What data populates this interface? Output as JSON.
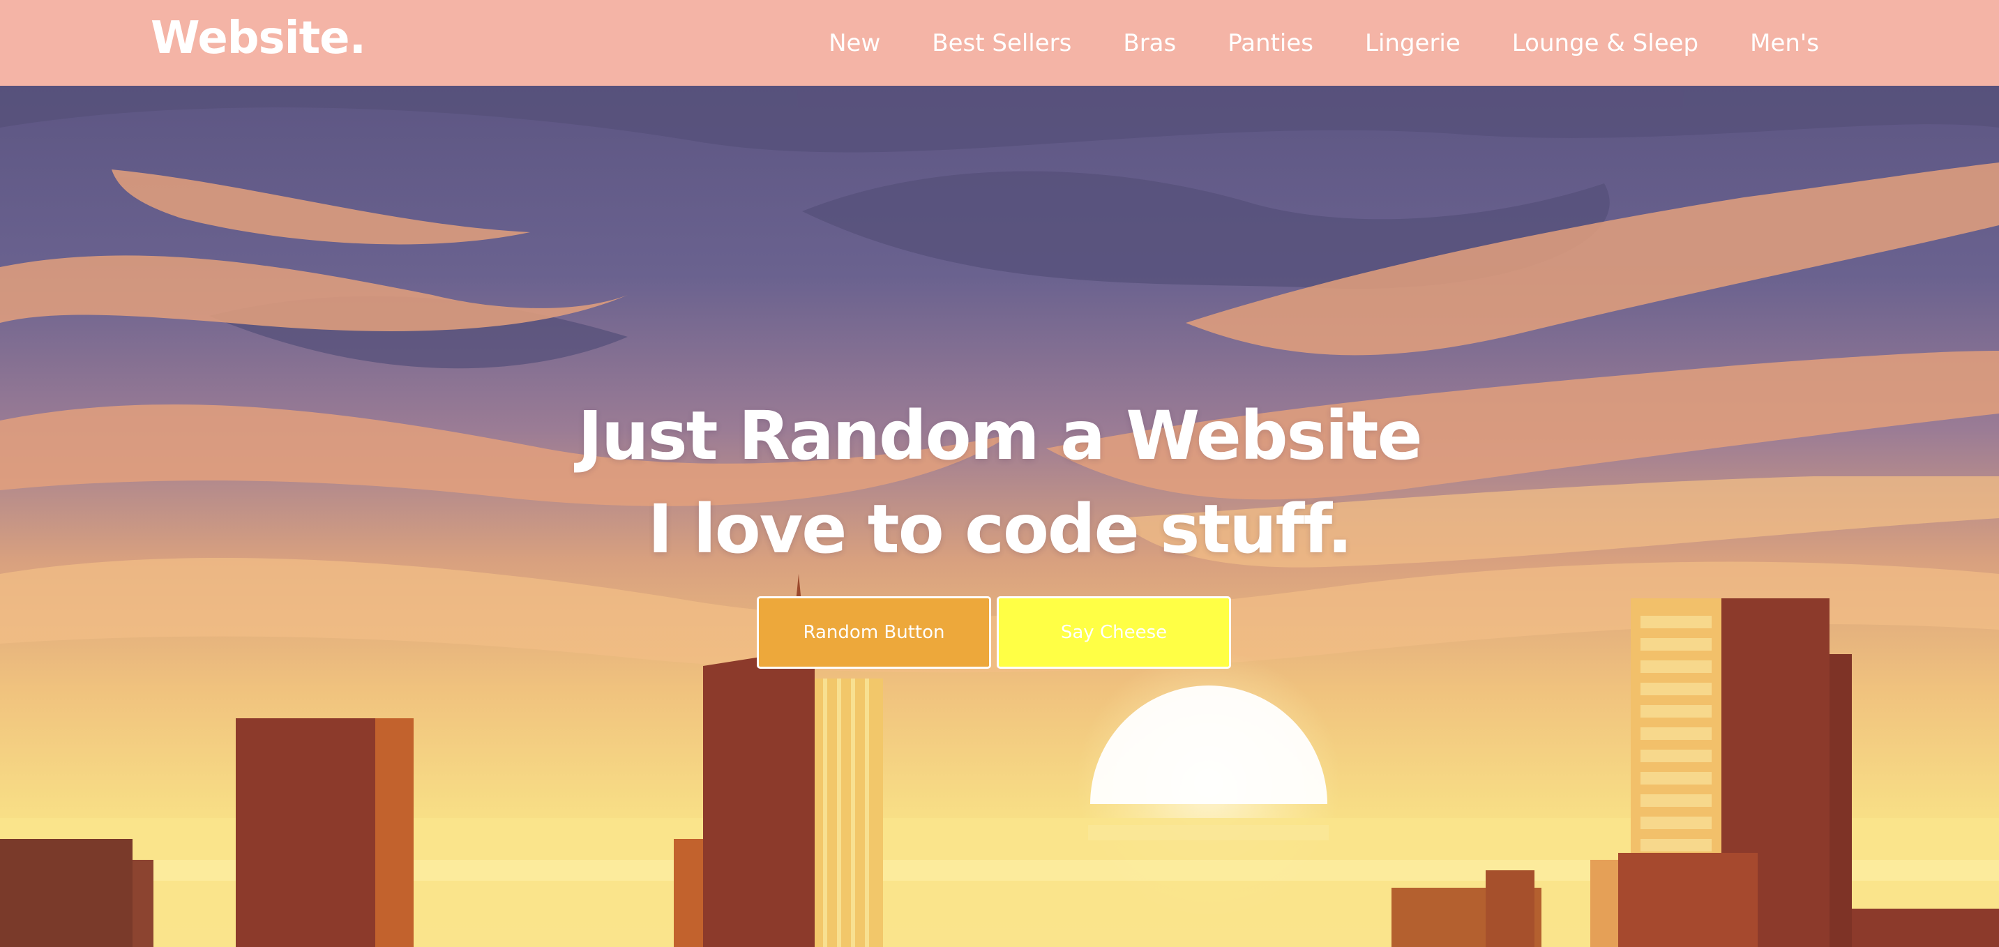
{
  "navbar": {
    "logo": "Website.",
    "links": [
      "New",
      "Best Sellers",
      "Bras",
      "Panties",
      "Lingerie",
      "Lounge & Sleep",
      "Men's"
    ]
  },
  "hero": {
    "title_line1": "Just Random a Website",
    "title_line2": "I love to code stuff.",
    "buttons": {
      "primary_label": "Random Button",
      "secondary_label": "Say Cheese"
    }
  },
  "colors": {
    "navbar_bg": "#f4b4a6",
    "primary_button": "#eda83b",
    "secondary_button": "#ffff45",
    "text": "#ffffff"
  }
}
